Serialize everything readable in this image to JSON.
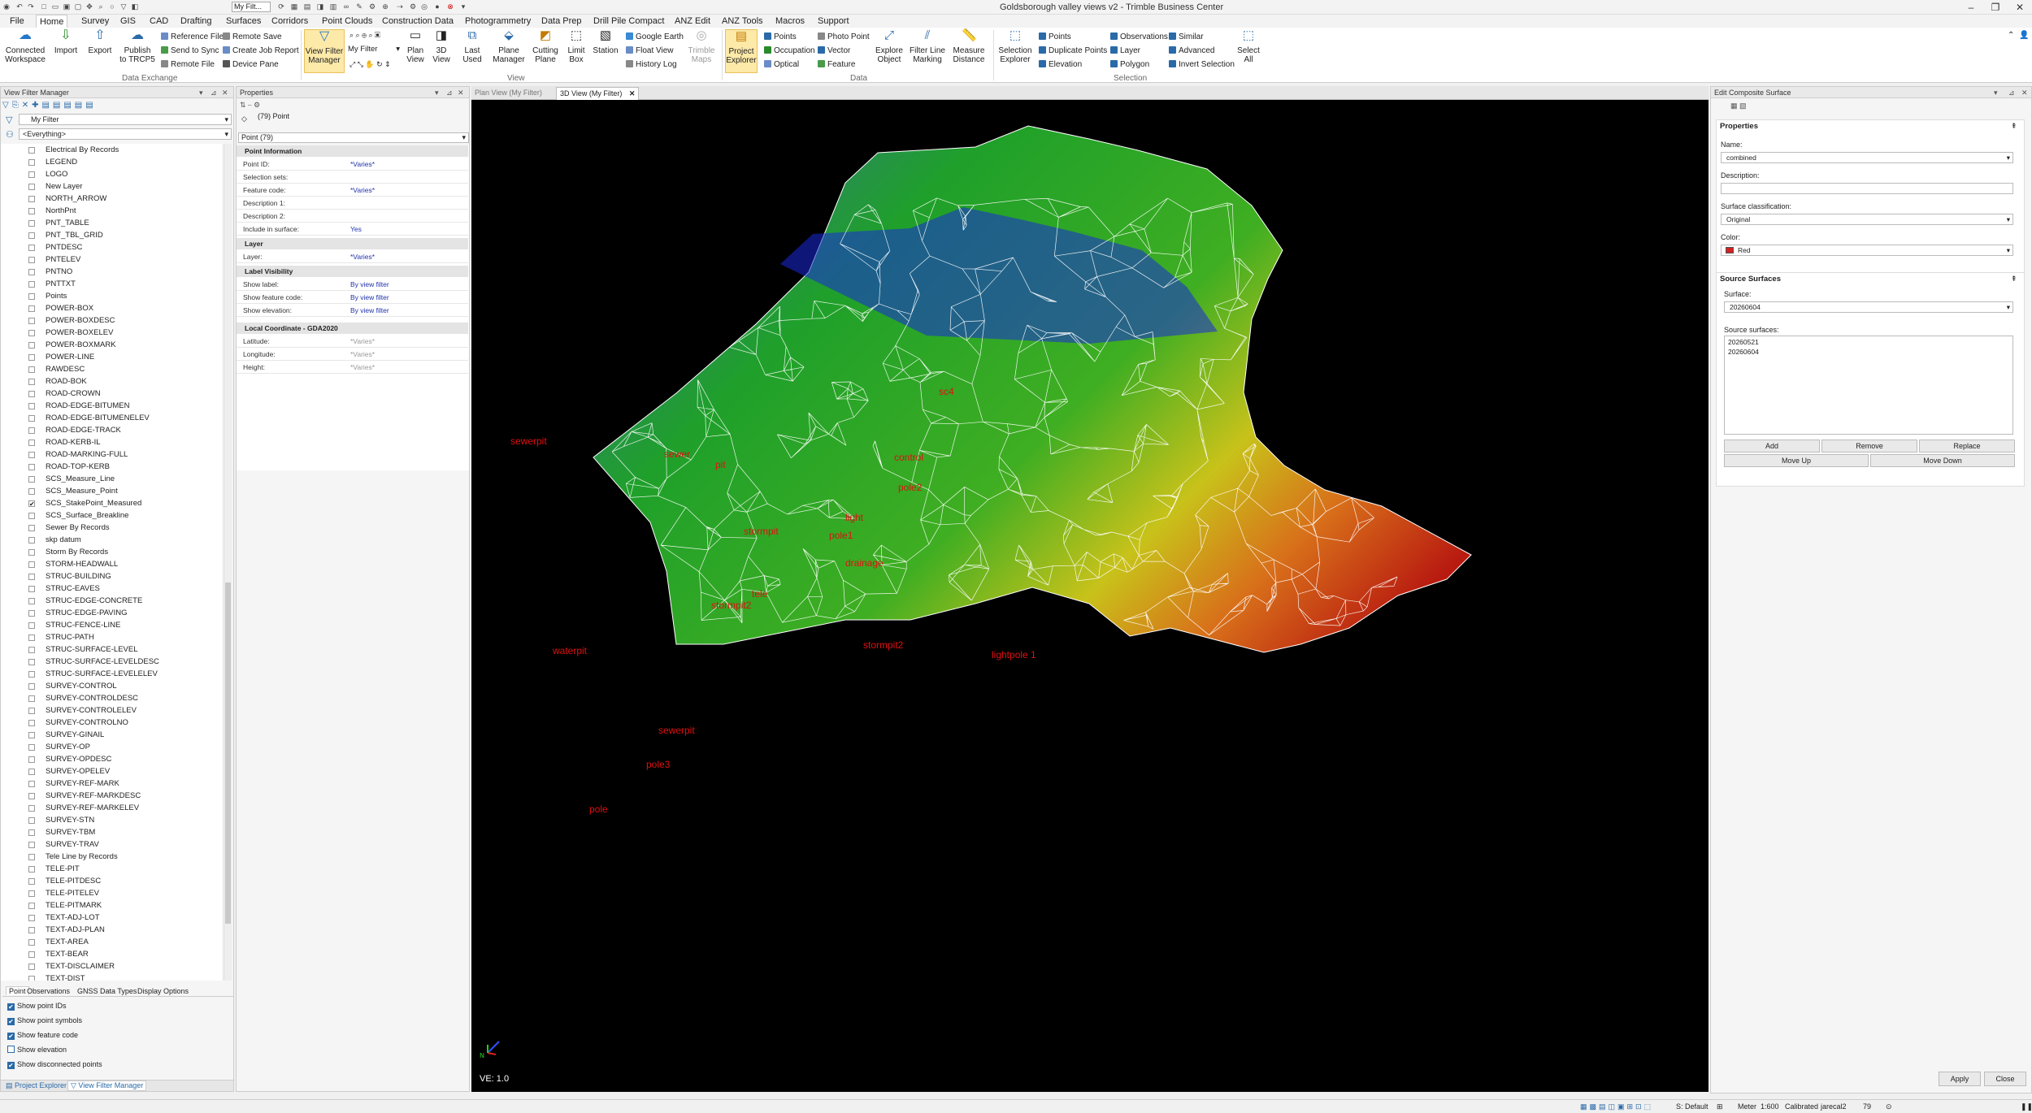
{
  "window": {
    "title": "Goldsborough valley views v2 - Trimble Business Center",
    "quick_filter": "My Filt..."
  },
  "menu": [
    "File",
    "Home",
    "Survey",
    "GIS",
    "CAD",
    "Drafting",
    "Surfaces",
    "Corridors",
    "Point Clouds",
    "Construction Data",
    "Photogrammetry",
    "Data Prep",
    "Drill Pile Compact",
    "ANZ Edit",
    "ANZ Tools",
    "Macros",
    "Support"
  ],
  "ribbon": {
    "connected": "Connected\nWorkspace",
    "import": "Import",
    "export": "Export",
    "publish": "Publish\nto TRCP5",
    "small1": [
      "Reference File",
      "Send to Sync",
      "Remote File"
    ],
    "small2": [
      "Remote Save",
      "Create Job Report",
      "Device Pane"
    ],
    "group_data_exchange": "Data Exchange",
    "view_filter_manager": "View Filter\nManager",
    "filter_name": "My Filter",
    "plan_view": "Plan\nView",
    "view3d": "3D\nView",
    "last_used": "Last\nUsed",
    "plane_manager": "Plane\nManager",
    "cutting_plane": "Cutting\nPlane",
    "limit_box": "Limit\nBox",
    "station": "Station",
    "small3": [
      "Google Earth",
      "Float View",
      "History Log"
    ],
    "trimble_maps": "Trimble\nMaps",
    "group_view": "View",
    "project_explorer": "Project\nExplorer",
    "small4": [
      "Points",
      "Occupation",
      "Optical"
    ],
    "small5": [
      "Photo Point",
      "Vector",
      "Feature"
    ],
    "explore_object": "Explore\nObject",
    "filter_line_marking": "Filter Line\nMarking",
    "measure_distance": "Measure\nDistance",
    "group_data": "Data",
    "selection_explorer": "Selection\nExplorer",
    "small6": [
      "Points",
      "Duplicate Points",
      "Elevation"
    ],
    "small7": [
      "Observations",
      "Layer",
      "Polygon"
    ],
    "small8": [
      "Similar",
      "Advanced",
      "Invert Selection"
    ],
    "select_all": "Select\nAll",
    "group_selection": "Selection"
  },
  "vfm": {
    "title": "View Filter Manager",
    "filter": "My Filter",
    "everything": "<Everything>",
    "layers": [
      "Electrical By Records",
      "LEGEND",
      "LOGO",
      "New Layer",
      "NORTH_ARROW",
      "NorthPnt",
      "PNT_TABLE",
      "PNT_TBL_GRID",
      "PNTDESC",
      "PNTELEV",
      "PNTNO",
      "PNTTXT",
      "Points",
      "POWER-BOX",
      "POWER-BOXDESC",
      "POWER-BOXELEV",
      "POWER-BOXMARK",
      "POWER-LINE",
      "RAWDESC",
      "ROAD-BOK",
      "ROAD-CROWN",
      "ROAD-EDGE-BITUMEN",
      "ROAD-EDGE-BITUMENELEV",
      "ROAD-EDGE-TRACK",
      "ROAD-KERB-IL",
      "ROAD-MARKING-FULL",
      "ROAD-TOP-KERB",
      "SCS_Measure_Line",
      "SCS_Measure_Point",
      "SCS_StakePoint_Measured",
      "SCS_Surface_Breakline",
      "Sewer By Records",
      "skp datum",
      "Storm By Records",
      "STORM-HEADWALL",
      "STRUC-BUILDING",
      "STRUC-EAVES",
      "STRUC-EDGE-CONCRETE",
      "STRUC-EDGE-PAVING",
      "STRUC-FENCE-LINE",
      "STRUC-PATH",
      "STRUC-SURFACE-LEVEL",
      "STRUC-SURFACE-LEVELDESC",
      "STRUC-SURFACE-LEVELELEV",
      "SURVEY-CONTROL",
      "SURVEY-CONTROLDESC",
      "SURVEY-CONTROLELEV",
      "SURVEY-CONTROLNO",
      "SURVEY-GINAIL",
      "SURVEY-OP",
      "SURVEY-OPDESC",
      "SURVEY-OPELEV",
      "SURVEY-REF-MARK",
      "SURVEY-REF-MARKDESC",
      "SURVEY-REF-MARKELEV",
      "SURVEY-STN",
      "SURVEY-TBM",
      "SURVEY-TRAV",
      "Tele Line by Records",
      "TELE-PIT",
      "TELE-PITDESC",
      "TELE-PITELEV",
      "TELE-PITMARK",
      "TEXT-ADJ-LOT",
      "TEXT-ADJ-PLAN",
      "TEXT-AREA",
      "TEXT-BEAR",
      "TEXT-DISCLAIMER",
      "TEXT-DIST"
    ],
    "checked_index": 29,
    "tabs": [
      "Point",
      "Observations",
      "GNSS Data Types",
      "Display Options"
    ],
    "options": [
      {
        "label": "Show point IDs",
        "on": true
      },
      {
        "label": "Show point symbols",
        "on": true
      },
      {
        "label": "Show feature code",
        "on": true
      },
      {
        "label": "Show elevation",
        "on": false
      },
      {
        "label": "Show disconnected points",
        "on": true
      }
    ],
    "bottom_tabs": [
      "Project Explorer",
      "View Filter Manager"
    ]
  },
  "props": {
    "title": "Properties",
    "header": "(79) Point",
    "selector": "Point (79)",
    "sec_info": "Point Information",
    "rows_info": [
      [
        "Point ID:",
        "*Varies*"
      ],
      [
        "Selection sets:",
        ""
      ],
      [
        "Feature code:",
        "*Varies*"
      ],
      [
        "Description 1:",
        ""
      ],
      [
        "Description 2:",
        ""
      ],
      [
        "Include in surface:",
        "Yes"
      ]
    ],
    "sec_layer": "Layer",
    "rows_layer": [
      [
        "Layer:",
        "*Varies*"
      ]
    ],
    "sec_label": "Label Visibility",
    "rows_label": [
      [
        "Show label:",
        "By view filter"
      ],
      [
        "Show feature code:",
        "By view filter"
      ],
      [
        "Show elevation:",
        "By view filter"
      ]
    ],
    "sec_local": "Local Coordinate - GDA2020",
    "rows_local": [
      [
        "Latitude:",
        "*Varies*"
      ],
      [
        "Longitude:",
        "*Varies*"
      ],
      [
        "Height:",
        "*Varies*"
      ]
    ]
  },
  "view": {
    "tabs": [
      "Plan View (My Filter)",
      "3D View (My Filter)"
    ],
    "ve": "VE: 1.0",
    "labels": [
      {
        "t": "pole6"
      },
      {
        "t": "sc4"
      },
      {
        "t": "sewerpit"
      },
      {
        "t": "control"
      },
      {
        "t": "pole2"
      },
      {
        "t": "sewer"
      },
      {
        "t": "pit"
      },
      {
        "t": "light"
      },
      {
        "t": "pole1"
      },
      {
        "t": "stormpit"
      },
      {
        "t": "drainage"
      },
      {
        "t": "tele"
      },
      {
        "t": "stormpit2"
      },
      {
        "t": "lightpole 1"
      },
      {
        "t": "waterpit"
      },
      {
        "t": "stormpit2"
      },
      {
        "t": "sewerpit"
      },
      {
        "t": "pole3"
      },
      {
        "t": "pole"
      },
      {
        "t": "kerb"
      }
    ]
  },
  "ecs": {
    "title": "Edit Composite Surface",
    "properties": "Properties",
    "name_lbl": "Name:",
    "name": "combined",
    "desc_lbl": "Description:",
    "class_lbl": "Surface classification:",
    "class": "Original",
    "color_lbl": "Color:",
    "color": "Red",
    "color_hex": "#d42020",
    "src_title": "Source Surfaces",
    "surface_lbl": "Surface:",
    "surface": "20260604",
    "src_lbl": "Source surfaces:",
    "sources": [
      "20260521",
      "20260604"
    ],
    "add": "Add",
    "remove": "Remove",
    "replace": "Replace",
    "move_up": "Move Up",
    "move_down": "Move Down",
    "apply": "Apply",
    "close": "Close"
  },
  "status": {
    "snap": "S: Default",
    "unit": "Meter",
    "scale": "1:600",
    "calib": "Calibrated",
    "user": "jarecal2",
    "count": "79"
  }
}
